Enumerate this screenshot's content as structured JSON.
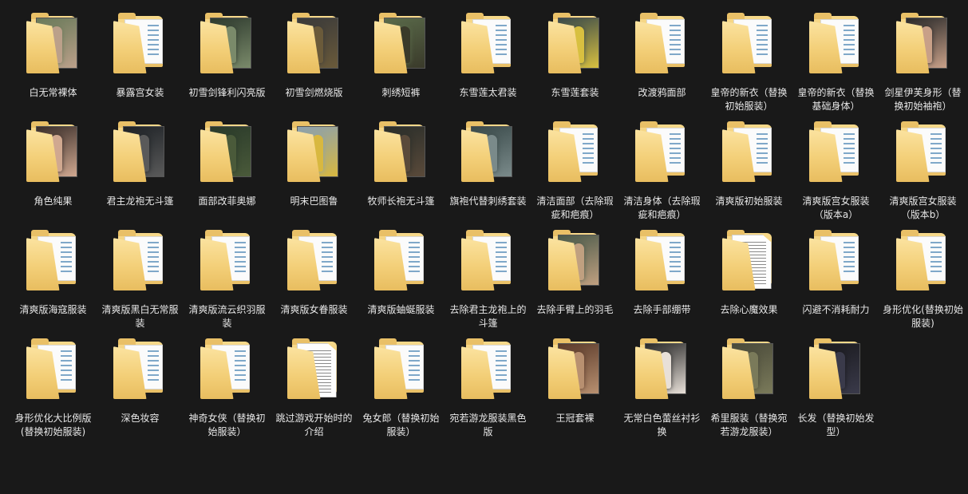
{
  "folders": [
    {
      "name": "白无常裸体",
      "thumb": "photo",
      "tint": [
        "#6a7a5a",
        "#bba08a"
      ]
    },
    {
      "name": "暴露宫女装",
      "thumb": "doc"
    },
    {
      "name": "初雪剑锋利闪亮版",
      "thumb": "photo",
      "tint": [
        "#2e3a2e",
        "#7a8a6a"
      ]
    },
    {
      "name": "初雪剑燃烧版",
      "thumb": "photo",
      "tint": [
        "#3a3a3a",
        "#6a5a3a"
      ]
    },
    {
      "name": "刺绣短裤",
      "thumb": "photo",
      "tint": [
        "#5a6a4a",
        "#3a3a2a"
      ]
    },
    {
      "name": "东雪莲太君装",
      "thumb": "doc"
    },
    {
      "name": "东雪莲套装",
      "thumb": "photo",
      "tint": [
        "#3a4a4a",
        "#d8c040"
      ]
    },
    {
      "name": "改渡鸦面部",
      "thumb": "doc"
    },
    {
      "name": "皇帝的新衣（替换初始服装）",
      "thumb": "doc"
    },
    {
      "name": "皇帝的新衣（替换基础身体）",
      "thumb": "doc"
    },
    {
      "name": "剑星伊芙身形（替换初始袖袍）",
      "thumb": "photo",
      "tint": [
        "#2a2a2a",
        "#c8a088"
      ]
    },
    {
      "name": "角色纯果",
      "thumb": "photo",
      "tint": [
        "#3a2e2a",
        "#d0a890"
      ]
    },
    {
      "name": "君主龙袍无斗篷",
      "thumb": "photo",
      "tint": [
        "#1e2226",
        "#5a5a5a"
      ]
    },
    {
      "name": "面部改菲奥娜",
      "thumb": "photo",
      "tint": [
        "#2a3a2a",
        "#4a5a3a"
      ]
    },
    {
      "name": "明末巴图鲁",
      "thumb": "photo",
      "tint": [
        "#8aa0b0",
        "#d8b840"
      ]
    },
    {
      "name": "牧师长袍无斗篷",
      "thumb": "photo",
      "tint": [
        "#2a2e2a",
        "#5a4a3a"
      ]
    },
    {
      "name": "旗袍代替刺绣套装",
      "thumb": "photo",
      "tint": [
        "#3a4a4a",
        "#7a8a8a"
      ]
    },
    {
      "name": "清洁面部（去除瑕疵和疤痕）",
      "thumb": "doc"
    },
    {
      "name": "清洁身体（去除瑕疵和疤痕）",
      "thumb": "doc"
    },
    {
      "name": "清爽版初始服装",
      "thumb": "doc"
    },
    {
      "name": "清爽版宫女服装（版本a）",
      "thumb": "doc"
    },
    {
      "name": "清爽版宫女服装（版本b）",
      "thumb": "doc"
    },
    {
      "name": "清爽版海寇服装",
      "thumb": "doc"
    },
    {
      "name": "清爽版黑白无常服装",
      "thumb": "doc"
    },
    {
      "name": "清爽版流云织羽服装",
      "thumb": "doc"
    },
    {
      "name": "清爽版女眷服装",
      "thumb": "doc"
    },
    {
      "name": "清爽版蚰蜒服装",
      "thumb": "doc"
    },
    {
      "name": "去除君主龙袍上的斗篷",
      "thumb": "doc"
    },
    {
      "name": "去除手臂上的羽毛",
      "thumb": "photo",
      "tint": [
        "#4a5a4a",
        "#c0a080"
      ]
    },
    {
      "name": "去除手部绷带",
      "thumb": "doc"
    },
    {
      "name": "去除心魔效果",
      "thumb": "file"
    },
    {
      "name": "闪避不消耗耐力",
      "thumb": "doc"
    },
    {
      "name": "身形优化(替换初始服装)",
      "thumb": "doc"
    },
    {
      "name": "身形优化大比例版(替换初始服装)",
      "thumb": "doc"
    },
    {
      "name": "深色妆容",
      "thumb": "doc"
    },
    {
      "name": "神奇女侠（替换初始服装）",
      "thumb": "doc"
    },
    {
      "name": "跳过游戏开始时的介绍",
      "thumb": "file"
    },
    {
      "name": "兔女郎（替换初始服装）",
      "thumb": "doc"
    },
    {
      "name": "宛若游龙服装黑色版",
      "thumb": "doc"
    },
    {
      "name": "王冠套裸",
      "thumb": "photo",
      "tint": [
        "#5a3a2a",
        "#b89070"
      ]
    },
    {
      "name": "无常白色蕾丝衬衫换",
      "thumb": "photo",
      "tint": [
        "#2a2a2a",
        "#e8e0d8"
      ]
    },
    {
      "name": "希里服装（替换宛若游龙服装）",
      "thumb": "photo",
      "tint": [
        "#4a4a3a",
        "#7a7a5a"
      ]
    },
    {
      "name": "长发（替换初始发型）",
      "thumb": "photo",
      "tint": [
        "#1a1a1e",
        "#3a3a4a"
      ]
    }
  ]
}
